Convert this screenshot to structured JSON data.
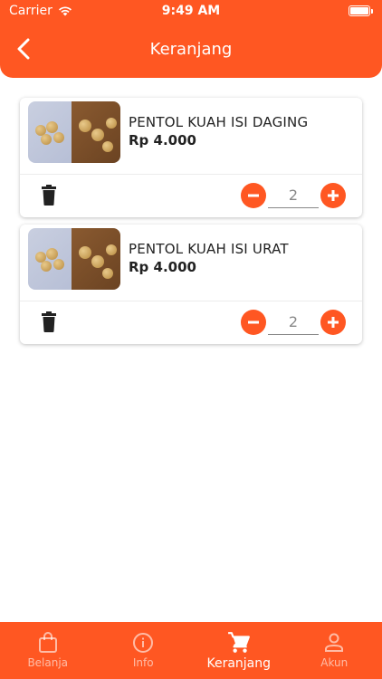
{
  "status_bar": {
    "carrier": "Carrier",
    "time": "9:49 AM"
  },
  "header": {
    "title": "Keranjang"
  },
  "cart": {
    "items": [
      {
        "name": "PENTOL KUAH ISI DAGING",
        "price": "Rp 4.000",
        "quantity": "2"
      },
      {
        "name": "PENTOL KUAH ISI URAT",
        "price": "Rp 4.000",
        "quantity": "2"
      }
    ]
  },
  "bottom_nav": {
    "items": [
      {
        "label": "Belanja",
        "icon": "shopping-bag-icon"
      },
      {
        "label": "Info",
        "icon": "info-icon"
      },
      {
        "label": "Keranjang",
        "icon": "cart-icon",
        "active": true
      },
      {
        "label": "Akun",
        "icon": "person-icon"
      }
    ]
  },
  "colors": {
    "accent": "#FF5722",
    "inactive_nav": "#FFB49C"
  }
}
